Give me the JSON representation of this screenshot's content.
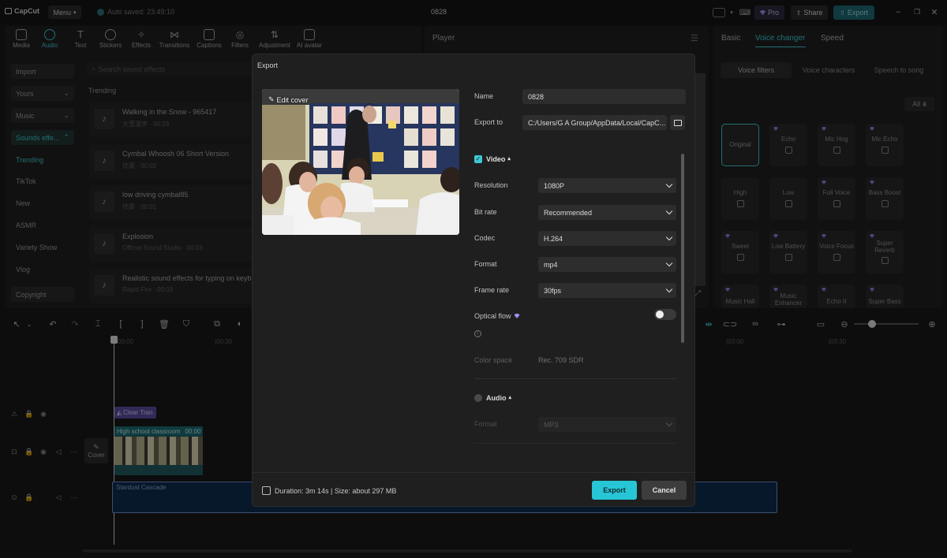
{
  "app": {
    "name": "CapCut",
    "menu_label": "Menu",
    "autosave_text": "Auto saved: 23:49:10",
    "project_title": "0828"
  },
  "titlebar": {
    "pro_label": "Pro",
    "share_label": "Share",
    "export_label": "Export"
  },
  "toolbar": {
    "items": [
      {
        "label": "Media"
      },
      {
        "label": "Audio"
      },
      {
        "label": "Text"
      },
      {
        "label": "Stickers"
      },
      {
        "label": "Effects"
      },
      {
        "label": "Transitions"
      },
      {
        "label": "Captions"
      },
      {
        "label": "Filters"
      },
      {
        "label": "Adjustment"
      },
      {
        "label": "AI avatar"
      }
    ]
  },
  "sidebar": {
    "items": [
      {
        "label": "Import"
      },
      {
        "label": "Yours"
      },
      {
        "label": "Music"
      },
      {
        "label": "Sounds effe..."
      },
      {
        "label": "Trending"
      },
      {
        "label": "TikTok"
      },
      {
        "label": "New"
      },
      {
        "label": "ASMR"
      },
      {
        "label": "Variety Show"
      },
      {
        "label": "Vlog"
      },
      {
        "label": "Copyright"
      }
    ]
  },
  "search": {
    "placeholder": "Search sound effects"
  },
  "sounds": {
    "section_title": "Trending",
    "items": [
      {
        "title": "Walking in the Snow - 965417",
        "meta": "大雪漫步 · 00:23"
      },
      {
        "title": "Cymbal Whoosh 06 Short Version",
        "meta": "优豪 · 00:02"
      },
      {
        "title": "low driving cymbal85",
        "meta": "优豪 · 00:01"
      },
      {
        "title": "Explosion",
        "meta": "Official Sound Studio · 00:03"
      },
      {
        "title": "Realistic sound effects for typing on keyb...",
        "meta": "Rapid Fire · 00:03"
      }
    ]
  },
  "player": {
    "title": "Player"
  },
  "right_panel": {
    "tabs": [
      {
        "label": "Basic"
      },
      {
        "label": "Voice changer"
      },
      {
        "label": "Speed"
      }
    ],
    "subtabs": [
      {
        "label": "Voice filters"
      },
      {
        "label": "Voice characters"
      },
      {
        "label": "Speech to song"
      }
    ],
    "filter_label": "All",
    "voices": [
      {
        "label": "Original"
      },
      {
        "label": "Echo"
      },
      {
        "label": "Mic Hog"
      },
      {
        "label": "Mic Echo"
      },
      {
        "label": "High"
      },
      {
        "label": "Low"
      },
      {
        "label": "Full Voice"
      },
      {
        "label": "Bass Boost"
      },
      {
        "label": "Sweet"
      },
      {
        "label": "Low Battery"
      },
      {
        "label": "Voice Focus"
      },
      {
        "label": "Super Reverb"
      },
      {
        "label": "Music Hall"
      },
      {
        "label": "Music Enhancer"
      },
      {
        "label": "Echo II"
      },
      {
        "label": "Super Bass"
      }
    ]
  },
  "timeline": {
    "ruler": [
      "00:00",
      "|00:30",
      "|03:00",
      "|03:30"
    ],
    "cover_label": "Cover",
    "effect_clip_label": "Clear Tran",
    "video_clip_label": "High school classroom",
    "video_clip_duration": "00:00",
    "audio_clip_label": "Stardust Cascade"
  },
  "export_dialog": {
    "title": "Export",
    "edit_cover_label": "Edit cover",
    "name_label": "Name",
    "name_value": "0828",
    "export_to_label": "Export to",
    "export_to_value": "C:/Users/G A Group/AppData/Local/CapC...",
    "video_section_label": "Video",
    "resolution_label": "Resolution",
    "resolution_value": "1080P",
    "bitrate_label": "Bit rate",
    "bitrate_value": "Recommended",
    "codec_label": "Codec",
    "codec_value": "H.264",
    "format_label": "Format",
    "format_value": "mp4",
    "framerate_label": "Frame rate",
    "framerate_value": "30fps",
    "optical_flow_label": "Optical flow",
    "color_space_label": "Color space",
    "color_space_value": "Rec. 709 SDR",
    "audio_section_label": "Audio",
    "audio_format_label": "Format",
    "audio_format_value": "MP3",
    "footer_info": "Duration: 3m 14s | Size: about 297 MB",
    "export_button": "Export",
    "cancel_button": "Cancel"
  },
  "colors": {
    "accent": "#3fc8d4",
    "background": "#181818",
    "panel": "#202020",
    "modal": "#1f1f1f",
    "gem": "#8a7bd8"
  }
}
